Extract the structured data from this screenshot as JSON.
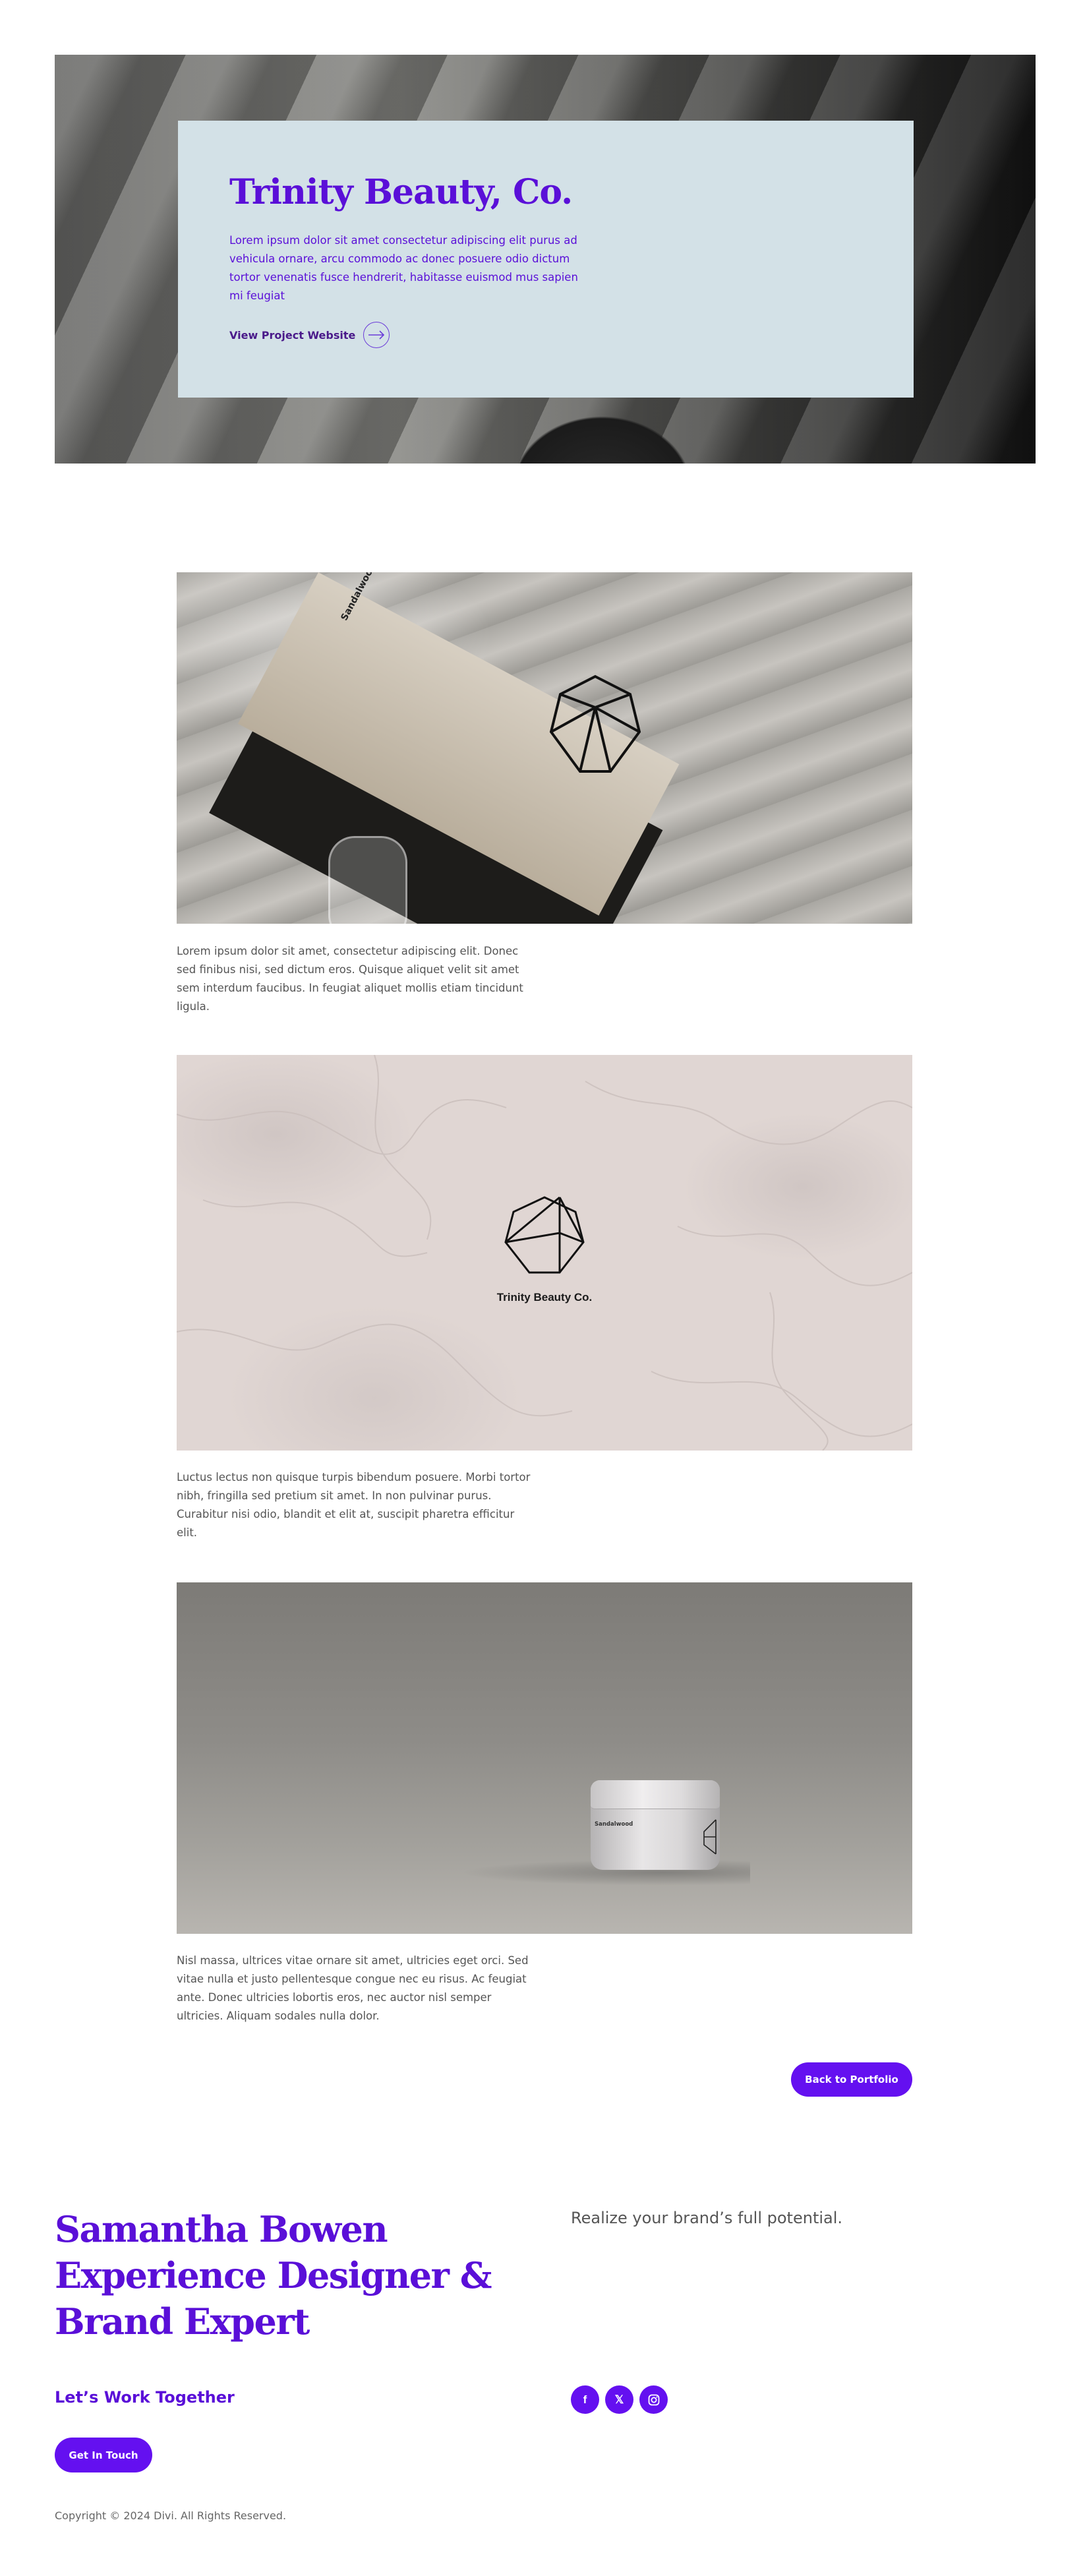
{
  "hero": {
    "title": "Trinity Beauty, Co.",
    "description": "Lorem ipsum dolor sit amet consectetur adipiscing elit purus ad vehicula ornare, arcu commodo ac donec posuere odio dictum tortor venenatis fusce hendrerit, habitasse euismod mus sapien mi feugiat",
    "link_label": "View Project Website",
    "link_icon": "arrow-right-circle-icon"
  },
  "gallery": [
    {
      "image": "product-box-photo",
      "image_text": "Sandalwood",
      "caption": "Lorem ipsum dolor sit amet, consectetur adipiscing elit. Donec sed finibus nisi, sed dictum eros. Quisque aliquet velit sit amet sem interdum faucibus. In feugiat aliquet mollis etiam tincidunt ligula."
    },
    {
      "image": "marble-logo-photo",
      "image_text": "Trinity Beauty Co.",
      "caption": "Luctus lectus non quisque turpis bibendum posuere. Morbi tortor nibh, fringilla sed pretium sit amet. In non pulvinar purus. Curabitur nisi odio, blandit et elit at, suscipit pharetra efficitur elit."
    },
    {
      "image": "cream-jar-photo",
      "image_text": "Sandalwood",
      "caption": "Nisl massa, ultrices vitae ornare sit amet, ultricies eget orci. Sed vitae nulla et justo pellentesque congue nec eu risus. Ac feugiat ante. Donec ultricies lobortis eros, nec auctor nisl semper ultricies. Aliquam sodales nulla dolor."
    }
  ],
  "back_button": "Back to Portfolio",
  "footer": {
    "name": "Samantha Bowen",
    "role": "Experience Designer & Brand Expert",
    "tagline": "Realize your brand’s full potential.",
    "work_heading": "Let’s Work Together",
    "cta": "Get In Touch",
    "social": [
      {
        "icon": "facebook-icon",
        "glyph": "f"
      },
      {
        "icon": "x-twitter-icon",
        "glyph": "𝕏"
      },
      {
        "icon": "instagram-icon",
        "glyph": ""
      }
    ],
    "copyright": "Copyright © 2024 Divi. All Rights Reserved."
  },
  "colors": {
    "accent": "#6410f0",
    "title_purple": "#5a0fd8",
    "hero_card_bg": "#d3e1e7",
    "body_text": "#555555"
  }
}
